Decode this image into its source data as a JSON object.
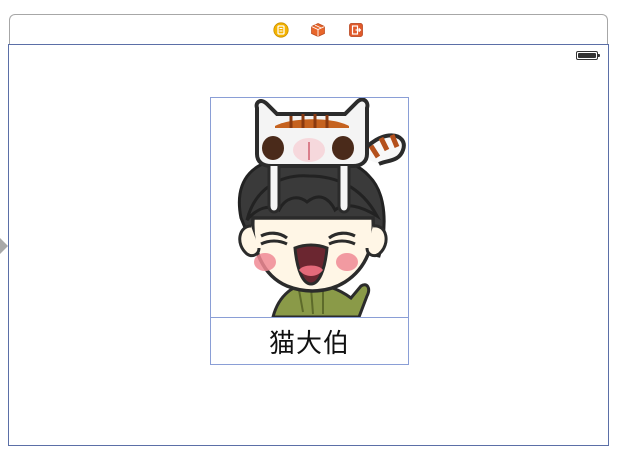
{
  "scene": {
    "dock_icons": [
      "view-controller-icon",
      "first-responder-icon",
      "exit-icon"
    ],
    "colors": {
      "canvas_border": "#5b6fa7",
      "view_border": "#8a9ed6",
      "vc_icon": "#f5b400",
      "responder_icon": "#e8662a",
      "exit_icon": "#e05a2b"
    }
  },
  "status_bar": {
    "battery_icon": "battery-icon",
    "battery_level": 1.0
  },
  "cell": {
    "image": "cartoon-boy-with-cat-on-head",
    "name_label": "猫大伯"
  }
}
